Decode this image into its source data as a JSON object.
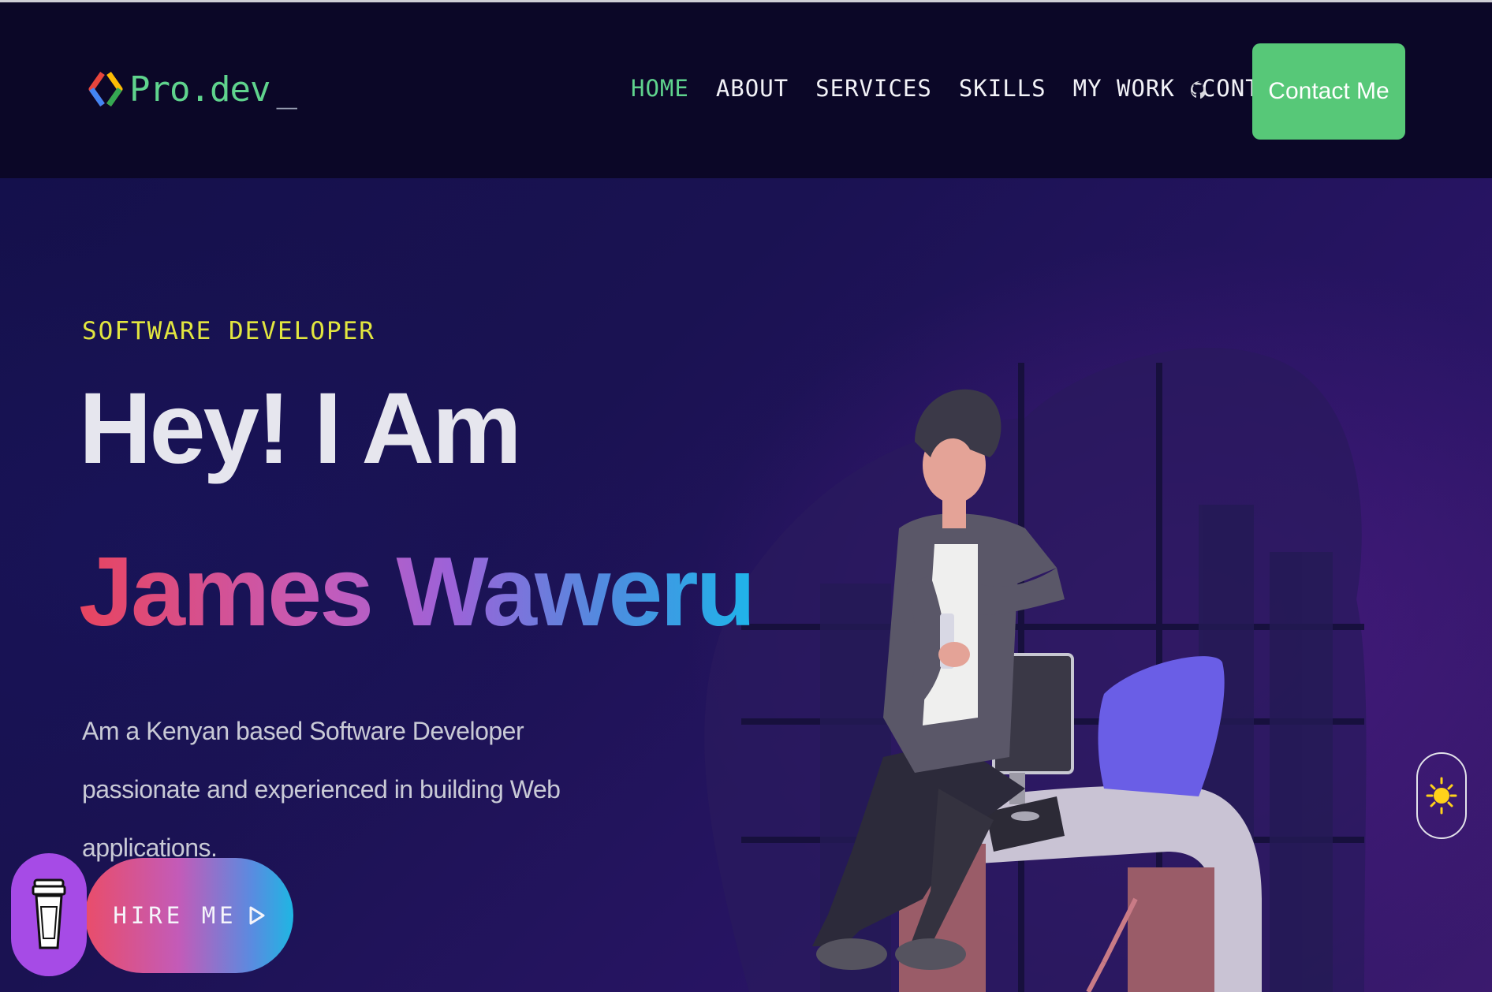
{
  "brand": {
    "name": "Pro.dev",
    "cursor": "_"
  },
  "nav": {
    "items": [
      {
        "label": "HOME",
        "active": true
      },
      {
        "label": "ABOUT",
        "active": false
      },
      {
        "label": "SERVICES",
        "active": false
      },
      {
        "label": "SKILLS",
        "active": false
      },
      {
        "label": "MY WORK",
        "active": false
      },
      {
        "label": "CONTACT",
        "active": false
      }
    ],
    "github_icon": "github-icon",
    "contact_button": "Contact Me"
  },
  "hero": {
    "subtitle": "SOFTWARE DEVELOPER",
    "greeting": "Hey! I Am",
    "name": "James Waweru",
    "description": "Am a Kenyan based Software Developer passionate and experienced in building Web applications.",
    "hire_button": "HIRE ME",
    "hire_icon": "play-outline-icon"
  },
  "widgets": {
    "buy_me_coffee_icon": "coffee-cup-icon",
    "theme_toggle_icon": "sun-icon"
  },
  "colors": {
    "accent_green": "#57c878",
    "active_nav": "#5fd38d",
    "subtitle_yellow": "#e2e63f",
    "name_gradient_start": "#e8445f",
    "name_gradient_end": "#1fb4ea",
    "coffee_purple": "#a64be6"
  }
}
